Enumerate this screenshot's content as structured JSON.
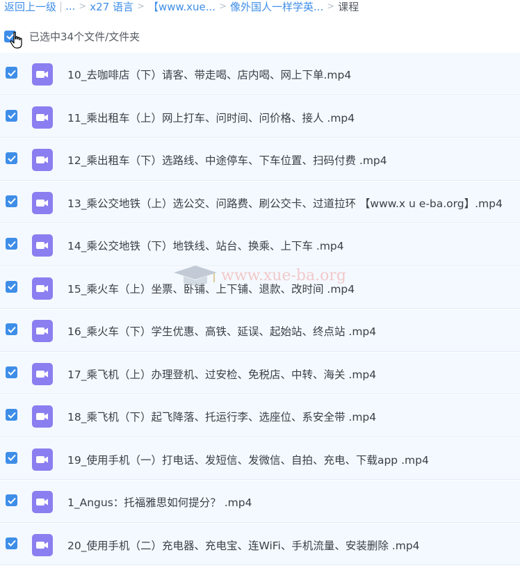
{
  "breadcrumb": {
    "back": "返回上一级",
    "ellipsis": "...",
    "items": [
      "x27 语言",
      "【www.xue...",
      "像外国人一样学英...",
      "课程"
    ]
  },
  "select_all": {
    "label": "已选中34个文件/文件夹",
    "checked": true
  },
  "files": [
    {
      "name": "10_去咖啡店（下）请客、带走喝、店内喝、网上下单.mp4",
      "checked": true
    },
    {
      "name": "11_乘出租车（上）网上打车、问时间、问价格、接人 .mp4",
      "checked": true
    },
    {
      "name": "12_乘出租车（下）选路线、中途停车、下车位置、扫码付费 .mp4",
      "checked": true
    },
    {
      "name": "13_乘公交地铁（上）选公交、问路费、刷公交卡、过道拉环 【www.x u e-ba.org】.mp4",
      "checked": true
    },
    {
      "name": "14_乘公交地铁（下）地铁线、站台、换乘、上下车 .mp4",
      "checked": true
    },
    {
      "name": "15_乘火车（上）坐票、卧铺、上下铺、退款、改时间 .mp4",
      "checked": true
    },
    {
      "name": "16_乘火车（下）学生优惠、高铁、延误、起始站、终点站 .mp4",
      "checked": true
    },
    {
      "name": "17_乘飞机（上）办理登机、过安检、免税店、中转、海关 .mp4",
      "checked": true
    },
    {
      "name": "18_乘飞机（下）起飞降落、托运行李、选座位、系安全带 .mp4",
      "checked": true
    },
    {
      "name": "19_使用手机（一）打电话、发短信、发微信、自拍、充电、下载app .mp4",
      "checked": true
    },
    {
      "name": "1_Angus：托福雅思如何提分？ .mp4",
      "checked": true
    },
    {
      "name": "20_使用手机（二）充电器、充电宝、连WiFi、手机流量、安装删除 .mp4",
      "checked": true
    }
  ],
  "watermark": {
    "text": "www.xue-ba.org"
  },
  "colors": {
    "accent": "#3e8ee8",
    "video_icon": "#8b7ef0",
    "row_bg": "#f4f9ff"
  },
  "icons": {
    "checkbox": "checkbox-checked-icon",
    "file": "video-file-icon",
    "cursor": "hand-pointer-icon"
  }
}
